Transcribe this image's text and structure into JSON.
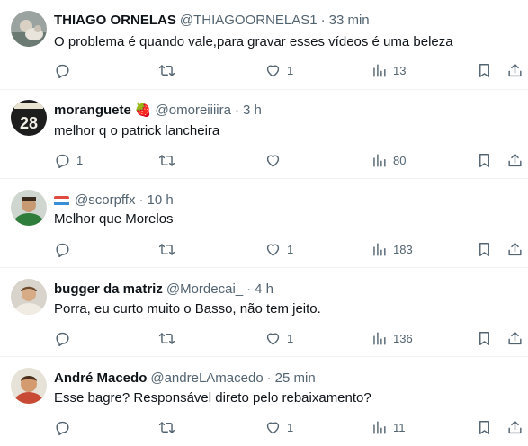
{
  "tweets": [
    {
      "name": "THIAGO ORNELAS",
      "handle": "@THIAGOORNELAS1",
      "time": "33 min",
      "text": "O problema é quando vale,para gravar esses vídeos é uma beleza",
      "replies": "",
      "retweets": "",
      "likes": "1",
      "views": "13"
    },
    {
      "name": "moranguete",
      "name_emoji": "🍓",
      "handle": "@omoreiiiira",
      "time": "3 h",
      "text": "melhor q o patrick lancheira",
      "replies": "1",
      "retweets": "",
      "likes": "",
      "views": "80"
    },
    {
      "name": "",
      "handle": "@scorpffx",
      "time": "10 h",
      "text": "Melhor que Morelos",
      "replies": "",
      "retweets": "",
      "likes": "1",
      "views": "183"
    },
    {
      "name": "bugger da matriz",
      "handle": "@Mordecai_",
      "time": "4 h",
      "text": "Porra, eu curto muito o Basso, não tem jeito.",
      "replies": "",
      "retweets": "",
      "likes": "1",
      "views": "136"
    },
    {
      "name": "André Macedo",
      "handle": "@andreLAmacedo",
      "time": "25 min",
      "text": "Esse bagre? Responsável direto pelo rebaixamento?",
      "replies": "",
      "retweets": "",
      "likes": "1",
      "views": "11"
    }
  ],
  "separator": "·",
  "colors": {
    "text_primary": "#0f1419",
    "text_secondary": "#536471",
    "divider": "#eff3f4"
  },
  "icons": [
    "reply-icon",
    "retweet-icon",
    "like-icon",
    "views-icon",
    "bookmark-icon",
    "share-icon"
  ]
}
